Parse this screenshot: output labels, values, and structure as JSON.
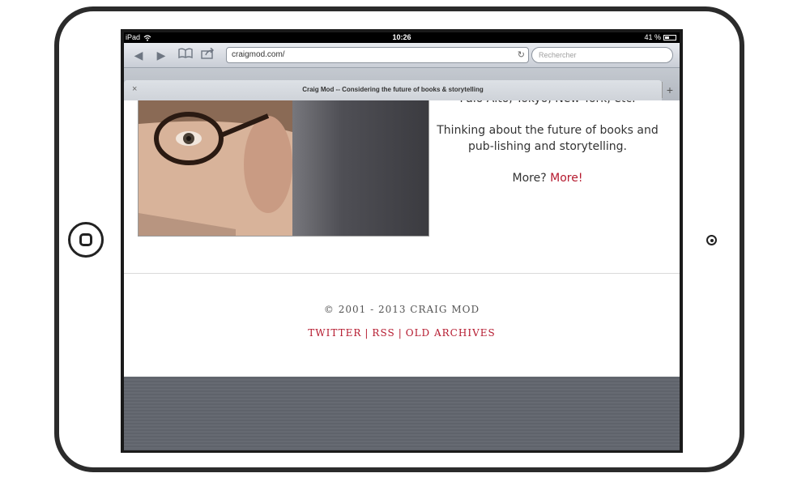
{
  "statusbar": {
    "device": "iPad",
    "time": "10:26",
    "battery": "41 %",
    "battery_level": 0.41
  },
  "toolbar": {
    "url": "craigmod.com/",
    "search_placeholder": "Rechercher",
    "icons": [
      "back-icon",
      "forward-icon",
      "bookmarks-icon",
      "share-icon",
      "reload-icon"
    ]
  },
  "tab": {
    "title": "Craig Mod -- Considering the future of books & storytelling",
    "close": "×",
    "new_tab": "+"
  },
  "page": {
    "intro_partial": "Palo Alto, Tokyo, New York, etc.",
    "intro_text": "Thinking about the future of books and pub-lishing and storytelling.",
    "more_prefix": "More?",
    "more_link": "More!",
    "copyright": "© 2001 - 2013 CRAIG MOD",
    "footer_links": [
      "TWITTER",
      "RSS",
      "OLD ARCHIVES"
    ],
    "separator": "|"
  },
  "colors": {
    "link": "#b5192e",
    "text": "#333333"
  }
}
